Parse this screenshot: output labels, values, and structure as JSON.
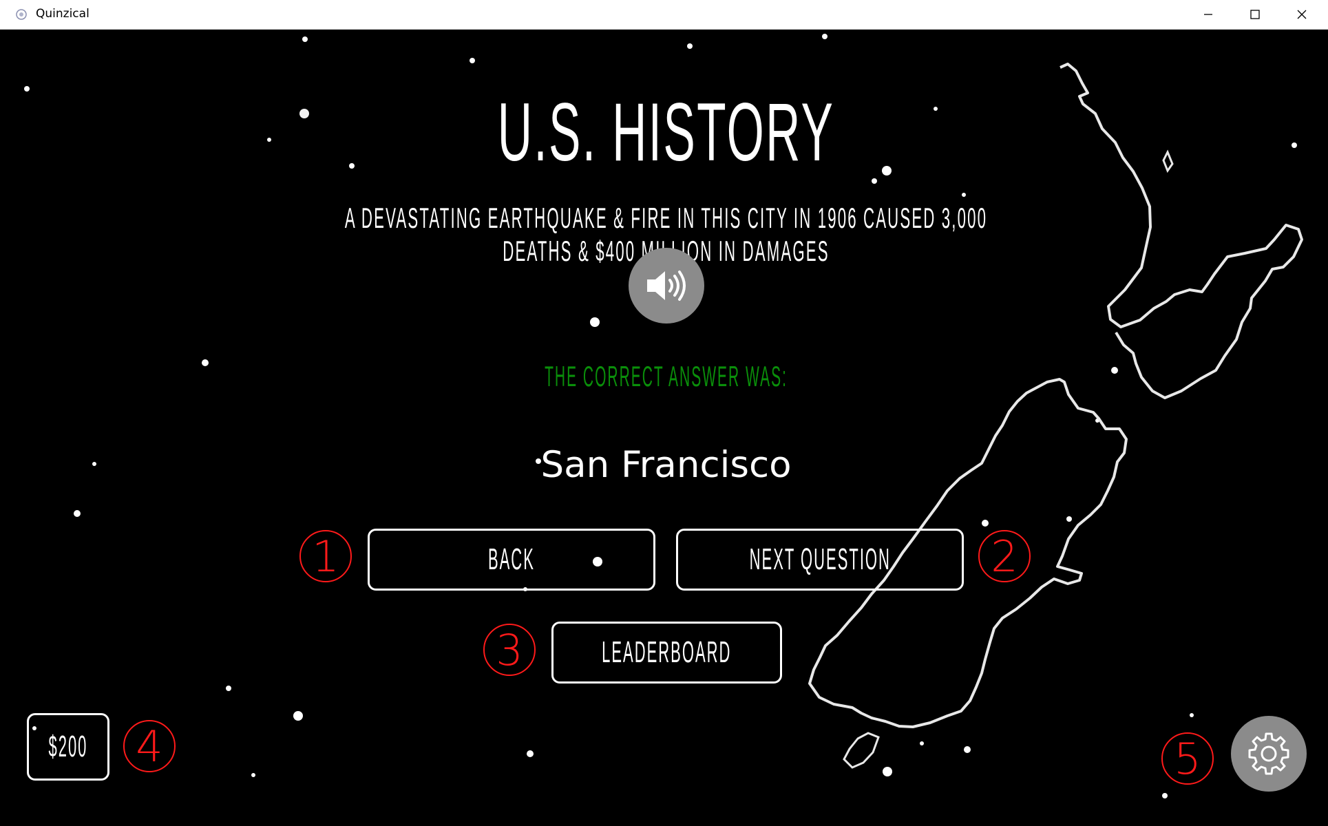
{
  "window": {
    "title": "Quinzical",
    "icon": "quinzical-app-icon"
  },
  "window_controls": {
    "minimize_icon": "minimize-icon",
    "maximize_icon": "maximize-icon",
    "close_icon": "close-icon"
  },
  "category": "U.S. HISTORY",
  "clue": "A DEVASTATING EARTHQUAKE & FIRE IN THIS CITY IN 1906 CAUSED 3,000 DEATHS & $400 MILLION IN DAMAGES",
  "speaker_icon": "speaker-icon",
  "answer": {
    "label": "THE CORRECT ANSWER WAS:",
    "value": "San Francisco",
    "label_color": "#0a8f0a"
  },
  "buttons": {
    "back": "BACK",
    "next": "NEXT QUESTION",
    "leaderboard": "LEADERBOARD"
  },
  "score": "$200",
  "settings_icon": "gear-icon",
  "markers": [
    "1",
    "2",
    "3",
    "4",
    "5"
  ],
  "colors": {
    "background": "#000000",
    "marker": "#ff1a1a",
    "round_button": "#8b8b8b"
  }
}
